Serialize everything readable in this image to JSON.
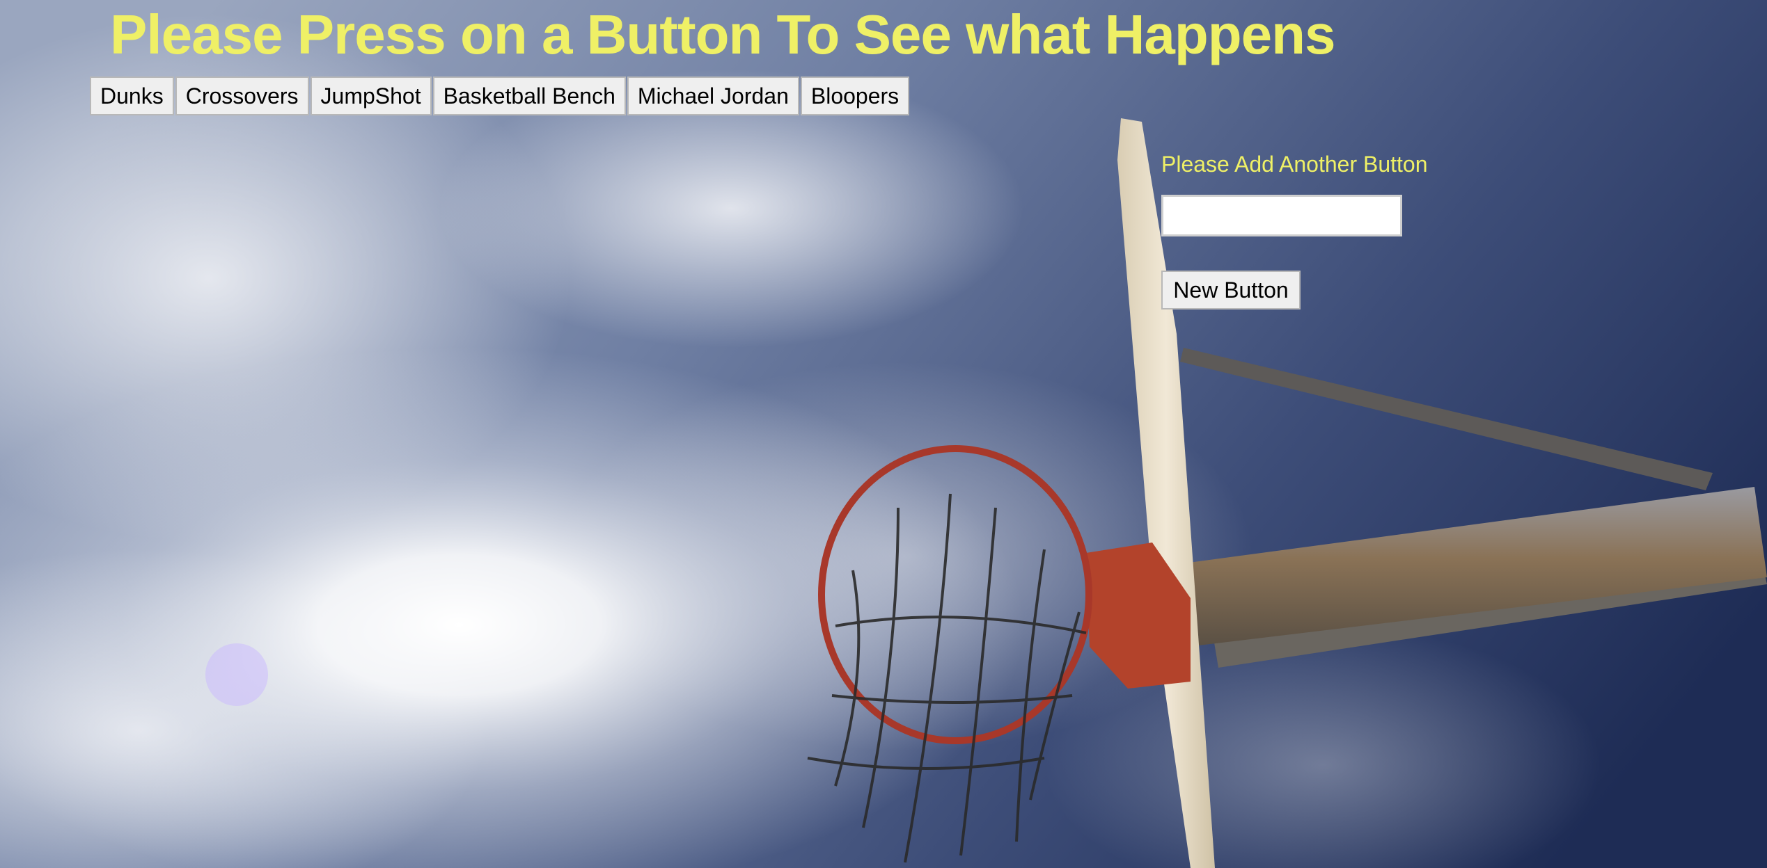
{
  "heading": {
    "title": "Please Press on a Button To See what Happens"
  },
  "topic_buttons": [
    {
      "label": "Dunks"
    },
    {
      "label": "Crossovers"
    },
    {
      "label": "JumpShot"
    },
    {
      "label": "Basketball Bench"
    },
    {
      "label": "Michael Jordan"
    },
    {
      "label": "Bloopers"
    }
  ],
  "add_form": {
    "label": "Please Add Another Button",
    "input_value": "",
    "submit_label": "New Button"
  },
  "colors": {
    "heading_text": "#eff066",
    "sky_dark": "#1e2c55",
    "rim": "#b3432b",
    "backboard": "#e9dfca"
  }
}
